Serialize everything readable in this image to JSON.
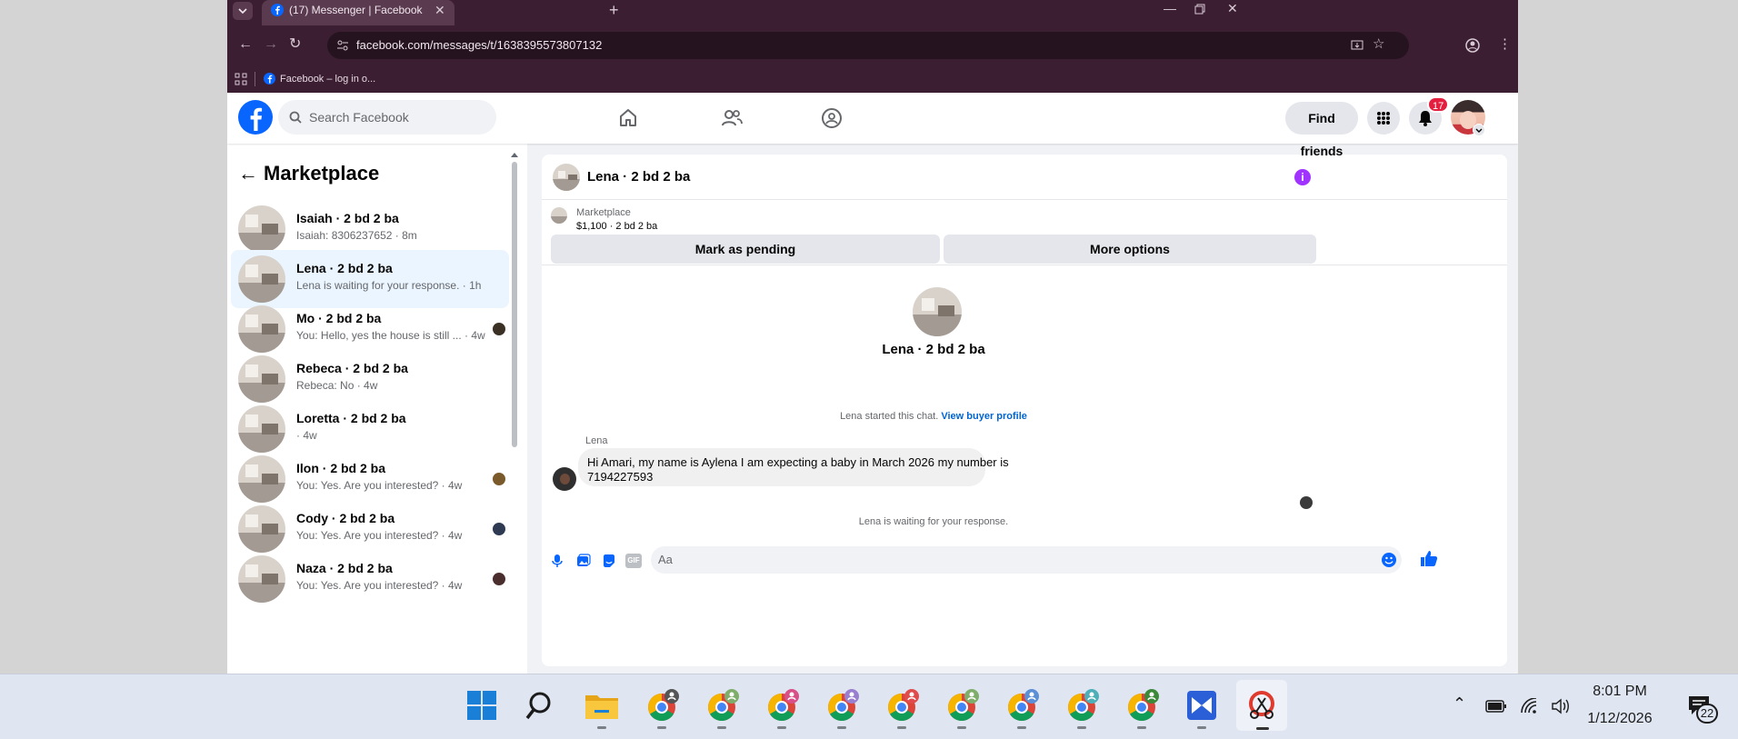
{
  "browser": {
    "tab_title": "(17) Messenger | Facebook",
    "url": "facebook.com/messages/t/1638395573807132",
    "bookmark": "Facebook – log in o..."
  },
  "facebook": {
    "search_placeholder": "Search Facebook",
    "find_friends": "Find friends",
    "notification_count": "17",
    "brand_color": "#0866ff"
  },
  "sidebar": {
    "title": "Marketplace",
    "conversations": [
      {
        "name": "Isaiah · 2 bd 2 ba",
        "snippet": "Isaiah: 8306237652 · 8m",
        "seen": false,
        "active": false
      },
      {
        "name": "Lena · 2 bd 2 ba",
        "snippet": "Lena is waiting for your response. · 1h",
        "seen": false,
        "active": true
      },
      {
        "name": "Mo · 2 bd 2 ba",
        "snippet": "You: Hello, yes the house is still ... · 4w",
        "seen": true,
        "active": false
      },
      {
        "name": "Rebeca · 2 bd 2 ba",
        "snippet": "Rebeca: No · 4w",
        "seen": false,
        "active": false
      },
      {
        "name": "Loretta · 2 bd 2 ba",
        "snippet": "· 4w",
        "seen": false,
        "active": false
      },
      {
        "name": "Ilon · 2 bd 2 ba",
        "snippet": "You: Yes. Are you interested? · 4w",
        "seen": true,
        "active": false
      },
      {
        "name": "Cody · 2 bd 2 ba",
        "snippet": "You: Yes. Are you interested? · 4w",
        "seen": true,
        "active": false
      },
      {
        "name": "Naza · 2 bd 2 ba",
        "snippet": "You: Yes. Are you interested? · 4w",
        "seen": true,
        "active": false
      }
    ]
  },
  "chat": {
    "header_title": "Lena · 2 bd 2 ba",
    "listing": {
      "source": "Marketplace",
      "details": "$1,100 · 2 bd 2 ba",
      "mark_pending": "Mark as pending",
      "more_options": "More options"
    },
    "intro_title": "Lena · 2 bd 2 ba",
    "started_text": "Lena started this chat.",
    "view_profile": "View buyer profile",
    "sender": "Lena",
    "message_line1": "Hi Amari, my name is Aylena I am expecting a baby in March 2026 my number is",
    "message_line2": "7194227593",
    "waiting_text": "Lena is waiting for your response.",
    "composer_placeholder": "Aa",
    "gif_label": "GIF"
  },
  "taskbar": {
    "time": "8:01 PM",
    "date": "1/12/2026",
    "notification_count": "22"
  }
}
